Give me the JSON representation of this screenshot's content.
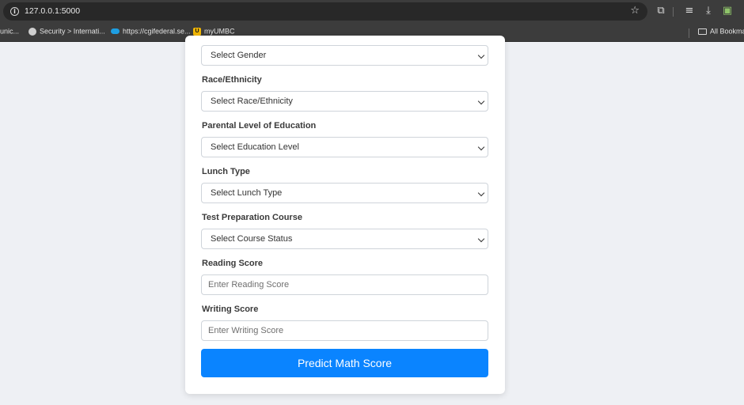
{
  "browser": {
    "url": "127.0.0.1:5000",
    "bookmarks": [
      {
        "label": "unic...",
        "icon": "partial-bookmark"
      },
      {
        "label": "Security > Internati...",
        "icon": "globe-icon"
      },
      {
        "label": "https://cgifederal.se...",
        "icon": "cloud-icon"
      },
      {
        "label": "myUMBC",
        "icon": "umbc-icon"
      }
    ],
    "all_bookmarks_label": "All Bookma"
  },
  "form": {
    "gender_select": "Select Gender",
    "race_label": "Race/Ethnicity",
    "race_select": "Select Race/Ethnicity",
    "education_label": "Parental Level of Education",
    "education_select": "Select Education Level",
    "lunch_label": "Lunch Type",
    "lunch_select": "Select Lunch Type",
    "prep_label": "Test Preparation Course",
    "prep_select": "Select Course Status",
    "reading_label": "Reading Score",
    "reading_placeholder": "Enter Reading Score",
    "writing_label": "Writing Score",
    "writing_placeholder": "Enter Writing Score",
    "submit_label": "Predict Math Score"
  },
  "colors": {
    "accent": "#0a84ff",
    "page_bg": "#eef0f4",
    "chrome_bg": "#3c3c3c"
  }
}
